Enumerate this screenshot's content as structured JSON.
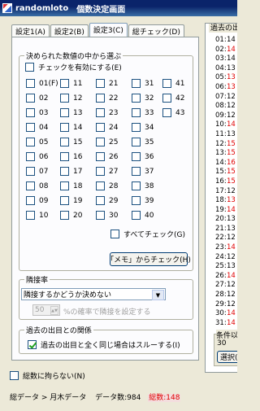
{
  "window": {
    "app_name": "randomloto",
    "title": "個数決定画面"
  },
  "tabs": [
    "設定1(A)",
    "設定2(B)",
    "設定3(C)",
    "総チェック(D)"
  ],
  "active_tab": 2,
  "number_group": {
    "legend": "決められた数値の中から選ぶ",
    "enable_label": "チェックを有効にする(E)",
    "numbers": [
      [
        "01(F)",
        "11",
        "21",
        "31",
        "41"
      ],
      [
        "02",
        "12",
        "22",
        "32",
        "42"
      ],
      [
        "03",
        "13",
        "23",
        "33",
        "43"
      ],
      [
        "04",
        "14",
        "24",
        "34",
        ""
      ],
      [
        "05",
        "15",
        "25",
        "35",
        ""
      ],
      [
        "06",
        "16",
        "26",
        "36",
        ""
      ],
      [
        "07",
        "17",
        "27",
        "37",
        ""
      ],
      [
        "08",
        "18",
        "28",
        "38",
        ""
      ],
      [
        "09",
        "19",
        "29",
        "39",
        ""
      ],
      [
        "10",
        "20",
        "30",
        "40",
        ""
      ]
    ],
    "check_all_label": "すべてチェック(G)",
    "memo_button": "「メモ」からチェック(H)"
  },
  "adjacent_group": {
    "legend": "隣接率",
    "select_value": "隣接するかどうか決めない",
    "spin_value": "50",
    "spin_caption": "%の確率で隣接を設定する"
  },
  "past_group": {
    "legend": "過去の出目との関係",
    "skip_label": "過去の出目と全く同じ場合はスルーする(I)",
    "skip_checked": true
  },
  "no_total_label": "総数に拘らない(N)",
  "right_panel": {
    "legend": "過去の出",
    "rows": [
      {
        "n": "01:",
        "v": "14",
        "red": false
      },
      {
        "n": "02:",
        "v": "14",
        "red": true
      },
      {
        "n": "03:",
        "v": "14",
        "red": false
      },
      {
        "n": "04:",
        "v": "13",
        "red": false
      },
      {
        "n": "05:",
        "v": "13",
        "red": true
      },
      {
        "n": "06:",
        "v": "13",
        "red": true
      },
      {
        "n": "07:",
        "v": "12",
        "red": false
      },
      {
        "n": "08:",
        "v": "12",
        "red": false
      },
      {
        "n": "09:",
        "v": "12",
        "red": false
      },
      {
        "n": "10:",
        "v": "14",
        "red": true
      },
      {
        "n": "11:",
        "v": "13",
        "red": false
      },
      {
        "n": "12:",
        "v": "15",
        "red": true
      },
      {
        "n": "13:",
        "v": "15",
        "red": true
      },
      {
        "n": "14:",
        "v": "16",
        "red": true
      },
      {
        "n": "15:",
        "v": "15",
        "red": true
      },
      {
        "n": "16:",
        "v": "15",
        "red": true
      },
      {
        "n": "17:",
        "v": "12",
        "red": false
      },
      {
        "n": "18:",
        "v": "13",
        "red": true
      },
      {
        "n": "19:",
        "v": "14",
        "red": true
      },
      {
        "n": "20:",
        "v": "13",
        "red": false
      },
      {
        "n": "21:",
        "v": "13",
        "red": false
      },
      {
        "n": "22:",
        "v": "12",
        "red": false
      },
      {
        "n": "23:",
        "v": "14",
        "red": true
      },
      {
        "n": "24:",
        "v": "12",
        "red": false
      },
      {
        "n": "25:",
        "v": "13",
        "red": false
      },
      {
        "n": "26:",
        "v": "14",
        "red": true
      },
      {
        "n": "27:",
        "v": "12",
        "red": false
      },
      {
        "n": "28:",
        "v": "12",
        "red": false
      },
      {
        "n": "29:",
        "v": "12",
        "red": false
      },
      {
        "n": "30:",
        "v": "14",
        "red": true
      },
      {
        "n": "31:",
        "v": "14",
        "red": true
      }
    ],
    "cond_legend": "条件以",
    "cond_value": "30",
    "select_button": "選択("
  },
  "footer": {
    "breadcrumb": "総データ > 月木データ",
    "data_count": "データ数:984",
    "total_count": "総数:148"
  },
  "colors": {
    "total_count": "#e00000",
    "title_bar": "#0a246a",
    "checkmark": "#21a121"
  }
}
